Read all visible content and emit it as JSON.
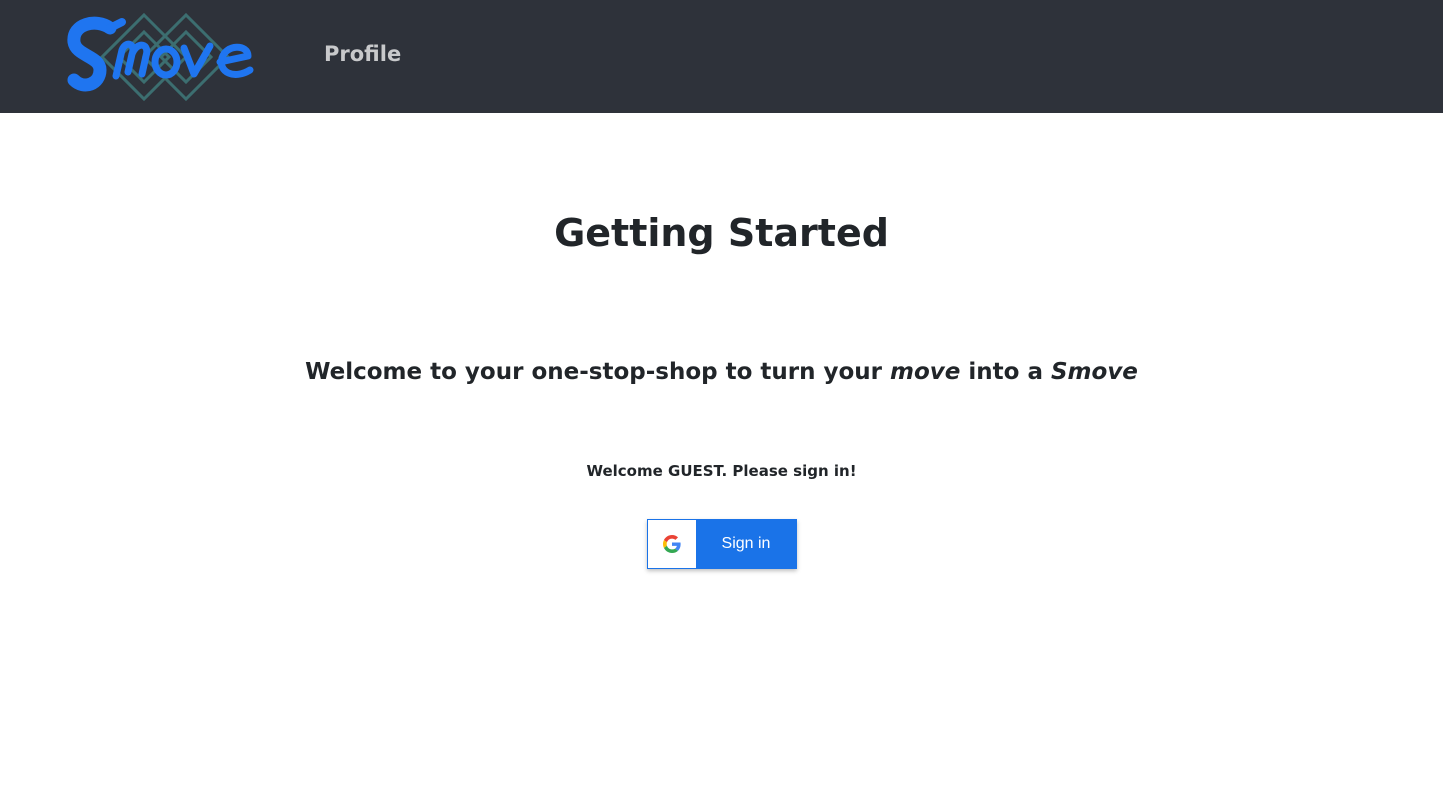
{
  "header": {
    "logo_text": "Smove",
    "nav": [
      {
        "label": "Profile"
      }
    ]
  },
  "main": {
    "title": "Getting Started",
    "welcome": {
      "prefix": "Welcome to your one-stop-shop to turn your ",
      "emph1": "move",
      "middle": " into a ",
      "emph2": "Smove"
    },
    "guest_message": "Welcome GUEST. Please sign in!",
    "sign_in": {
      "label": "Sign in",
      "icon": "google-icon"
    }
  },
  "colors": {
    "navbar": "#2e323a",
    "logo_blue": "#1f75f0",
    "logo_teal": "#3c6e70",
    "nav_text": "#c8c9cb",
    "button_blue": "#1a73e8",
    "text": "#212529"
  }
}
